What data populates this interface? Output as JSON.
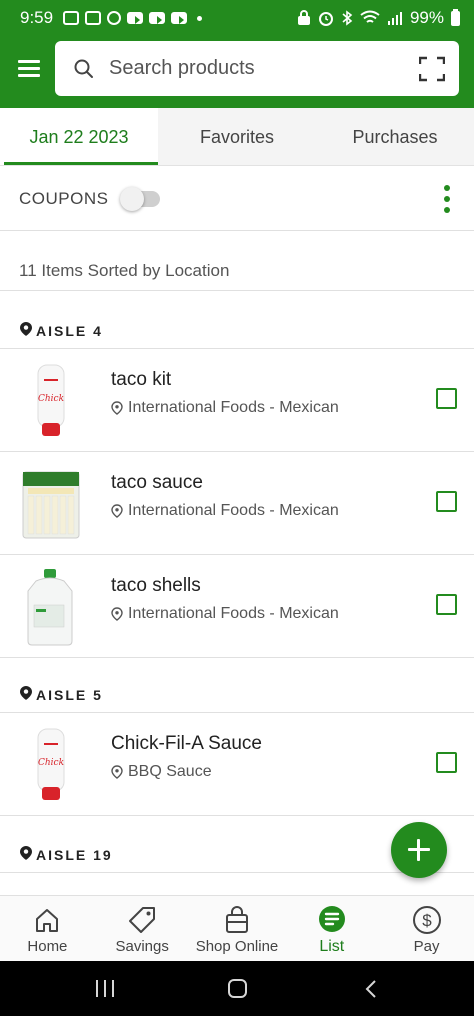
{
  "status_bar": {
    "time": "9:59",
    "battery": "99%"
  },
  "search": {
    "placeholder": "Search products"
  },
  "tabs": [
    {
      "label": "Jan 22 2023",
      "active": true
    },
    {
      "label": "Favorites",
      "active": false
    },
    {
      "label": "Purchases",
      "active": false
    }
  ],
  "coupons": {
    "label": "COUPONS",
    "enabled": false
  },
  "summary": "11 Items Sorted by Location",
  "aisles": [
    {
      "label": "AISLE 4",
      "items": [
        {
          "name": "taco kit",
          "location": "International Foods - Mexican",
          "image": "sauce-bottle",
          "checked": false
        },
        {
          "name": "taco sauce",
          "location": "International Foods - Mexican",
          "image": "cheese-pack",
          "checked": false
        },
        {
          "name": "taco shells",
          "location": "International Foods - Mexican",
          "image": "milk-jug",
          "checked": false
        }
      ]
    },
    {
      "label": "AISLE 5",
      "items": [
        {
          "name": "Chick-Fil-A Sauce",
          "location": "BBQ Sauce",
          "image": "sauce-bottle",
          "checked": false
        }
      ]
    },
    {
      "label": "AISLE 19",
      "items": []
    }
  ],
  "bottom_nav": [
    {
      "label": "Home",
      "icon": "home-icon",
      "active": false
    },
    {
      "label": "Savings",
      "icon": "tag-icon",
      "active": false
    },
    {
      "label": "Shop Online",
      "icon": "shopping-bag-icon",
      "active": false
    },
    {
      "label": "List",
      "icon": "list-icon",
      "active": true
    },
    {
      "label": "Pay",
      "icon": "dollar-icon",
      "active": false
    }
  ],
  "colors": {
    "brand_green": "#238b1e",
    "active_text": "#1e7d1c"
  }
}
